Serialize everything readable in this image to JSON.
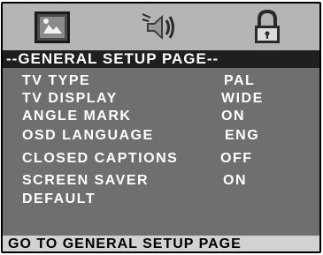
{
  "tabs": [
    {
      "icon": "general-setup-icon",
      "active": true
    },
    {
      "icon": "audio-setup-icon",
      "active": false
    },
    {
      "icon": "password-lock-icon",
      "active": false
    }
  ],
  "header": {
    "title": "--GENERAL SETUP PAGE--"
  },
  "settings": [
    {
      "label": "TV TYPE",
      "value": "PAL"
    },
    {
      "label": "TV DISPLAY",
      "value": "WIDE"
    },
    {
      "label": "ANGLE MARK",
      "value": "ON"
    },
    {
      "label": "OSD LANGUAGE",
      "value": "ENG"
    },
    {
      "label": "CLOSED CAPTIONS",
      "value": "OFF"
    },
    {
      "label": "SCREEN SAVER",
      "value": "ON"
    },
    {
      "label": "DEFAULT",
      "value": ""
    }
  ],
  "status": {
    "text": "GO TO GENERAL SETUP PAGE"
  },
  "colors": {
    "icon_bar": "#b5b5b5",
    "header_bg": "#1f1f1f",
    "panel_bg": "#6f6f6f",
    "status_bg": "#d2d2d2",
    "text": "#ffffff"
  }
}
